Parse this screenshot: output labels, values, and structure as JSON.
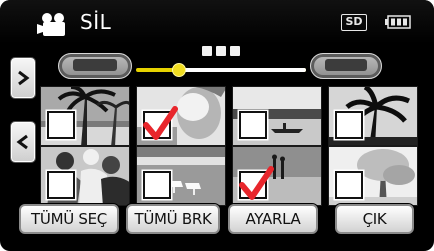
{
  "title_bar": {
    "mode_icon": "video-camera-icon",
    "title": "SİL",
    "media_badge": "SD",
    "battery_icon": "battery-icon"
  },
  "navigation": {
    "next_icon": "chevron-right-icon",
    "prev_icon": "chevron-left-icon",
    "page_position": 0.2
  },
  "thumbnails": [
    {
      "scene": "palm-trees-beach",
      "selected": false
    },
    {
      "scene": "person-selfie",
      "selected": true
    },
    {
      "scene": "boat-lake",
      "selected": false
    },
    {
      "scene": "palm-silhouette",
      "selected": false
    },
    {
      "scene": "people-group",
      "selected": false
    },
    {
      "scene": "beach-chairs",
      "selected": false
    },
    {
      "scene": "couple-sunset",
      "selected": true
    },
    {
      "scene": "bright-tree",
      "selected": false
    }
  ],
  "actions": {
    "select_all": "TÜMÜ SEÇ",
    "deselect_all": "TÜMÜ BRK",
    "set": "AYARLA",
    "exit": "ÇIK"
  },
  "colors": {
    "slider_accent": "#e6d200",
    "checkmark": "#e8262c"
  }
}
